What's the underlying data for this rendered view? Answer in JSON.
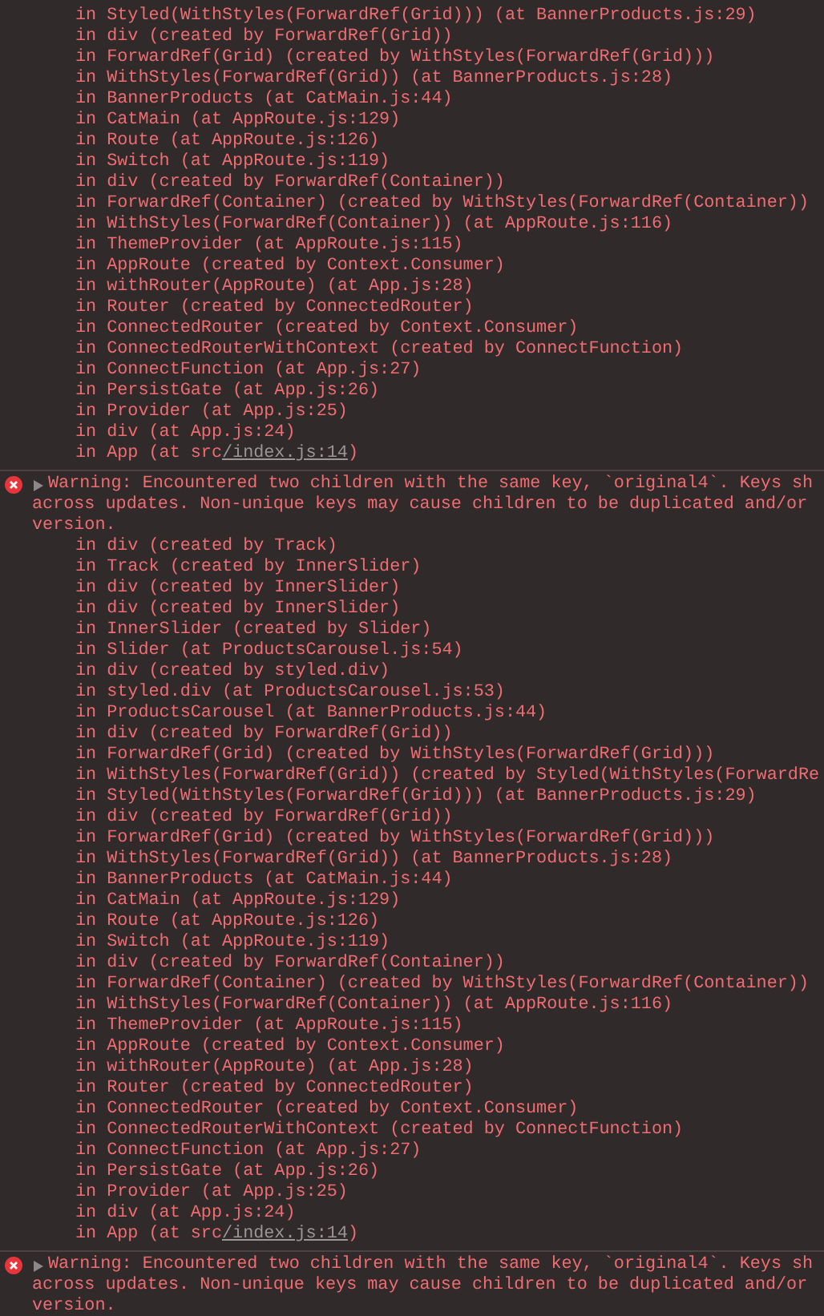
{
  "messages": [
    {
      "kind": "trace",
      "stack": [
        {
          "text": "in Styled(WithStyles(ForwardRef(Grid))) (at BannerProducts.js:29)"
        },
        {
          "text": "in div (created by ForwardRef(Grid))"
        },
        {
          "text": "in ForwardRef(Grid) (created by WithStyles(ForwardRef(Grid)))"
        },
        {
          "text": "in WithStyles(ForwardRef(Grid)) (at BannerProducts.js:28)"
        },
        {
          "text": "in BannerProducts (at CatMain.js:44)"
        },
        {
          "text": "in CatMain (at AppRoute.js:129)"
        },
        {
          "text": "in Route (at AppRoute.js:126)"
        },
        {
          "text": "in Switch (at AppRoute.js:119)"
        },
        {
          "text": "in div (created by ForwardRef(Container))"
        },
        {
          "text": "in ForwardRef(Container) (created by WithStyles(ForwardRef(Container))"
        },
        {
          "text": "in WithStyles(ForwardRef(Container)) (at AppRoute.js:116)"
        },
        {
          "text": "in ThemeProvider (at AppRoute.js:115)"
        },
        {
          "text": "in AppRoute (created by Context.Consumer)"
        },
        {
          "text": "in withRouter(AppRoute) (at App.js:28)"
        },
        {
          "text": "in Router (created by ConnectedRouter)"
        },
        {
          "text": "in ConnectedRouter (created by Context.Consumer)"
        },
        {
          "text": "in ConnectedRouterWithContext (created by ConnectFunction)"
        },
        {
          "text": "in ConnectFunction (at App.js:27)"
        },
        {
          "text": "in PersistGate (at App.js:26)"
        },
        {
          "text": "in Provider (at App.js:25)"
        },
        {
          "text": "in div (at App.js:24)"
        },
        {
          "text": "in App (at src",
          "link": "/index.js:14",
          "suffix": ")"
        }
      ]
    },
    {
      "kind": "error",
      "expanded": false,
      "text": [
        "Warning: Encountered two children with the same key, `original4`. Keys sh",
        "across updates. Non-unique keys may cause children to be duplicated and/or",
        "version."
      ],
      "stack": [
        {
          "text": "in div (created by Track)"
        },
        {
          "text": "in Track (created by InnerSlider)"
        },
        {
          "text": "in div (created by InnerSlider)"
        },
        {
          "text": "in div (created by InnerSlider)"
        },
        {
          "text": "in InnerSlider (created by Slider)"
        },
        {
          "text": "in Slider (at ProductsCarousel.js:54)"
        },
        {
          "text": "in div (created by styled.div)"
        },
        {
          "text": "in styled.div (at ProductsCarousel.js:53)"
        },
        {
          "text": "in ProductsCarousel (at BannerProducts.js:44)"
        },
        {
          "text": "in div (created by ForwardRef(Grid))"
        },
        {
          "text": "in ForwardRef(Grid) (created by WithStyles(ForwardRef(Grid)))"
        },
        {
          "text": "in WithStyles(ForwardRef(Grid)) (created by Styled(WithStyles(ForwardRe"
        },
        {
          "text": "in Styled(WithStyles(ForwardRef(Grid))) (at BannerProducts.js:29)"
        },
        {
          "text": "in div (created by ForwardRef(Grid))"
        },
        {
          "text": "in ForwardRef(Grid) (created by WithStyles(ForwardRef(Grid)))"
        },
        {
          "text": "in WithStyles(ForwardRef(Grid)) (at BannerProducts.js:28)"
        },
        {
          "text": "in BannerProducts (at CatMain.js:44)"
        },
        {
          "text": "in CatMain (at AppRoute.js:129)"
        },
        {
          "text": "in Route (at AppRoute.js:126)"
        },
        {
          "text": "in Switch (at AppRoute.js:119)"
        },
        {
          "text": "in div (created by ForwardRef(Container))"
        },
        {
          "text": "in ForwardRef(Container) (created by WithStyles(ForwardRef(Container))"
        },
        {
          "text": "in WithStyles(ForwardRef(Container)) (at AppRoute.js:116)"
        },
        {
          "text": "in ThemeProvider (at AppRoute.js:115)"
        },
        {
          "text": "in AppRoute (created by Context.Consumer)"
        },
        {
          "text": "in withRouter(AppRoute) (at App.js:28)"
        },
        {
          "text": "in Router (created by ConnectedRouter)"
        },
        {
          "text": "in ConnectedRouter (created by Context.Consumer)"
        },
        {
          "text": "in ConnectedRouterWithContext (created by ConnectFunction)"
        },
        {
          "text": "in ConnectFunction (at App.js:27)"
        },
        {
          "text": "in PersistGate (at App.js:26)"
        },
        {
          "text": "in Provider (at App.js:25)"
        },
        {
          "text": "in div (at App.js:24)"
        },
        {
          "text": "in App (at src",
          "link": "/index.js:14",
          "suffix": ")"
        }
      ]
    },
    {
      "kind": "error",
      "expanded": false,
      "text": [
        "Warning: Encountered two children with the same key, `original4`. Keys sh",
        "across updates. Non-unique keys may cause children to be duplicated and/or",
        "version."
      ]
    }
  ]
}
